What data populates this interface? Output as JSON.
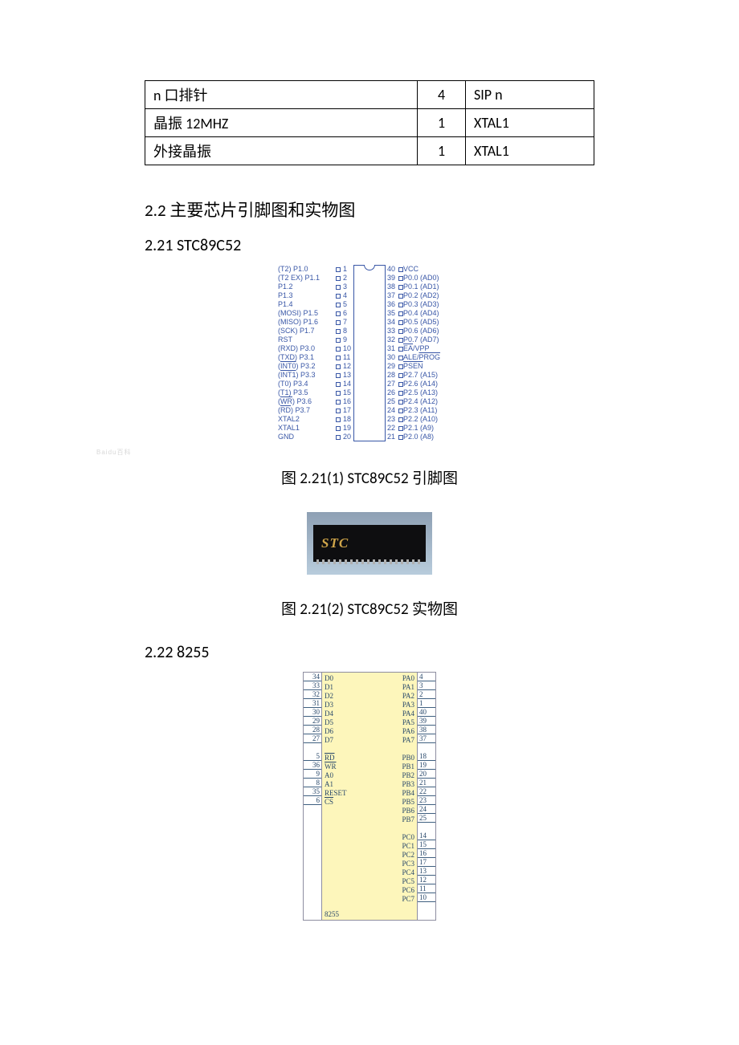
{
  "parts_table": [
    {
      "name": "n 口排针",
      "qty": "4",
      "ref": "SIP n"
    },
    {
      "name": "晶振 12MHZ",
      "qty": "1",
      "ref": "XTAL1"
    },
    {
      "name": "外接晶振",
      "qty": "1",
      "ref": "XTAL1"
    }
  ],
  "section_2_2": "2.2  主要芯片引脚图和实物图",
  "section_2_21": "2.21    STC89C52",
  "caption_2_21_1": "图 2.21(1) STC89C52 引脚图",
  "caption_2_21_2": "图 2.21(2) STC89C52 实物图",
  "section_2_22": "2.22    8255",
  "chip_logo": "STC",
  "stc_pins_left": [
    {
      "label": "(T2) P1.0",
      "num": "1"
    },
    {
      "label": "(T2 EX) P1.1",
      "num": "2"
    },
    {
      "label": "P1.2",
      "num": "3"
    },
    {
      "label": "P1.3",
      "num": "4"
    },
    {
      "label": "P1.4",
      "num": "5"
    },
    {
      "label": "(MOSI) P1.5",
      "num": "6"
    },
    {
      "label": "(MISO) P1.6",
      "num": "7"
    },
    {
      "label": "(SCK) P1.7",
      "num": "8"
    },
    {
      "label": "RST",
      "num": "9"
    },
    {
      "label": "(RXD) P3.0",
      "num": "10"
    },
    {
      "label": "(TXD) P3.1",
      "num": "11"
    },
    {
      "label": "(INT0) P3.2",
      "num": "12",
      "ov": true,
      "ov_text": "INT0"
    },
    {
      "label": "(INT1) P3.3",
      "num": "13",
      "ov": true,
      "ov_text": "INT1"
    },
    {
      "label": "(T0) P3.4",
      "num": "14"
    },
    {
      "label": "(T1) P3.5",
      "num": "15"
    },
    {
      "label": "(WR) P3.6",
      "num": "16",
      "ov": true,
      "ov_text": "WR"
    },
    {
      "label": "(RD) P3.7",
      "num": "17",
      "ov": true,
      "ov_text": "RD"
    },
    {
      "label": "XTAL2",
      "num": "18"
    },
    {
      "label": "XTAL1",
      "num": "19"
    },
    {
      "label": "GND",
      "num": "20"
    }
  ],
  "stc_pins_right": [
    {
      "label": "VCC",
      "num": "40"
    },
    {
      "label": "P0.0 (AD0)",
      "num": "39"
    },
    {
      "label": "P0.1 (AD1)",
      "num": "38"
    },
    {
      "label": "P0.2 (AD2)",
      "num": "37"
    },
    {
      "label": "P0.3 (AD3)",
      "num": "36"
    },
    {
      "label": "P0.4 (AD4)",
      "num": "35"
    },
    {
      "label": "P0.5 (AD5)",
      "num": "34"
    },
    {
      "label": "P0.6 (AD6)",
      "num": "33"
    },
    {
      "label": "P0.7 (AD7)",
      "num": "32"
    },
    {
      "label": "EA/VPP",
      "num": "31",
      "ov": true,
      "ov_text": "EA"
    },
    {
      "label": "ALE/PROG",
      "num": "30",
      "ov": true,
      "ov_text": "PROG"
    },
    {
      "label": "PSEN",
      "num": "29",
      "ov": true,
      "ov_text": "PSEN"
    },
    {
      "label": "P2.7 (A15)",
      "num": "28"
    },
    {
      "label": "P2.6 (A14)",
      "num": "27"
    },
    {
      "label": "P2.5 (A13)",
      "num": "26"
    },
    {
      "label": "P2.4 (A12)",
      "num": "25"
    },
    {
      "label": "P2.3 (A11)",
      "num": "24"
    },
    {
      "label": "P2.2 (A10)",
      "num": "23"
    },
    {
      "label": "P2.1 (A9)",
      "num": "22"
    },
    {
      "label": "P2.0 (A8)",
      "num": "21"
    }
  ],
  "p8255_left": [
    {
      "pin": "34",
      "lbl": "D0"
    },
    {
      "pin": "33",
      "lbl": "D1"
    },
    {
      "pin": "32",
      "lbl": "D2"
    },
    {
      "pin": "31",
      "lbl": "D3"
    },
    {
      "pin": "30",
      "lbl": "D4"
    },
    {
      "pin": "29",
      "lbl": "D5"
    },
    {
      "pin": "28",
      "lbl": "D6"
    },
    {
      "pin": "27",
      "lbl": "D7"
    },
    {
      "blank": true
    },
    {
      "pin": "5",
      "lbl": "RD",
      "ov": true
    },
    {
      "pin": "36",
      "lbl": "WR",
      "ov": true
    },
    {
      "pin": "9",
      "lbl": "A0"
    },
    {
      "pin": "8",
      "lbl": "A1"
    },
    {
      "pin": "35",
      "lbl": "RESET"
    },
    {
      "pin": "6",
      "lbl": "CS",
      "ov": true
    }
  ],
  "p8255_right": [
    {
      "pin": "4",
      "lbl": "PA0"
    },
    {
      "pin": "3",
      "lbl": "PA1"
    },
    {
      "pin": "2",
      "lbl": "PA2"
    },
    {
      "pin": "1",
      "lbl": "PA3"
    },
    {
      "pin": "40",
      "lbl": "PA4"
    },
    {
      "pin": "39",
      "lbl": "PA5"
    },
    {
      "pin": "38",
      "lbl": "PA6"
    },
    {
      "pin": "37",
      "lbl": "PA7"
    },
    {
      "blank": true
    },
    {
      "pin": "18",
      "lbl": "PB0"
    },
    {
      "pin": "19",
      "lbl": "PB1"
    },
    {
      "pin": "20",
      "lbl": "PB2"
    },
    {
      "pin": "21",
      "lbl": "PB3"
    },
    {
      "pin": "22",
      "lbl": "PB4"
    },
    {
      "pin": "23",
      "lbl": "PB5"
    },
    {
      "pin": "24",
      "lbl": "PB6"
    },
    {
      "pin": "25",
      "lbl": "PB7"
    },
    {
      "blank": true
    },
    {
      "pin": "14",
      "lbl": "PC0"
    },
    {
      "pin": "15",
      "lbl": "PC1"
    },
    {
      "pin": "16",
      "lbl": "PC2"
    },
    {
      "pin": "17",
      "lbl": "PC3"
    },
    {
      "pin": "13",
      "lbl": "PC4"
    },
    {
      "pin": "12",
      "lbl": "PC5"
    },
    {
      "pin": "11",
      "lbl": "PC6"
    },
    {
      "pin": "10",
      "lbl": "PC7"
    }
  ],
  "p8255_name": "8255"
}
